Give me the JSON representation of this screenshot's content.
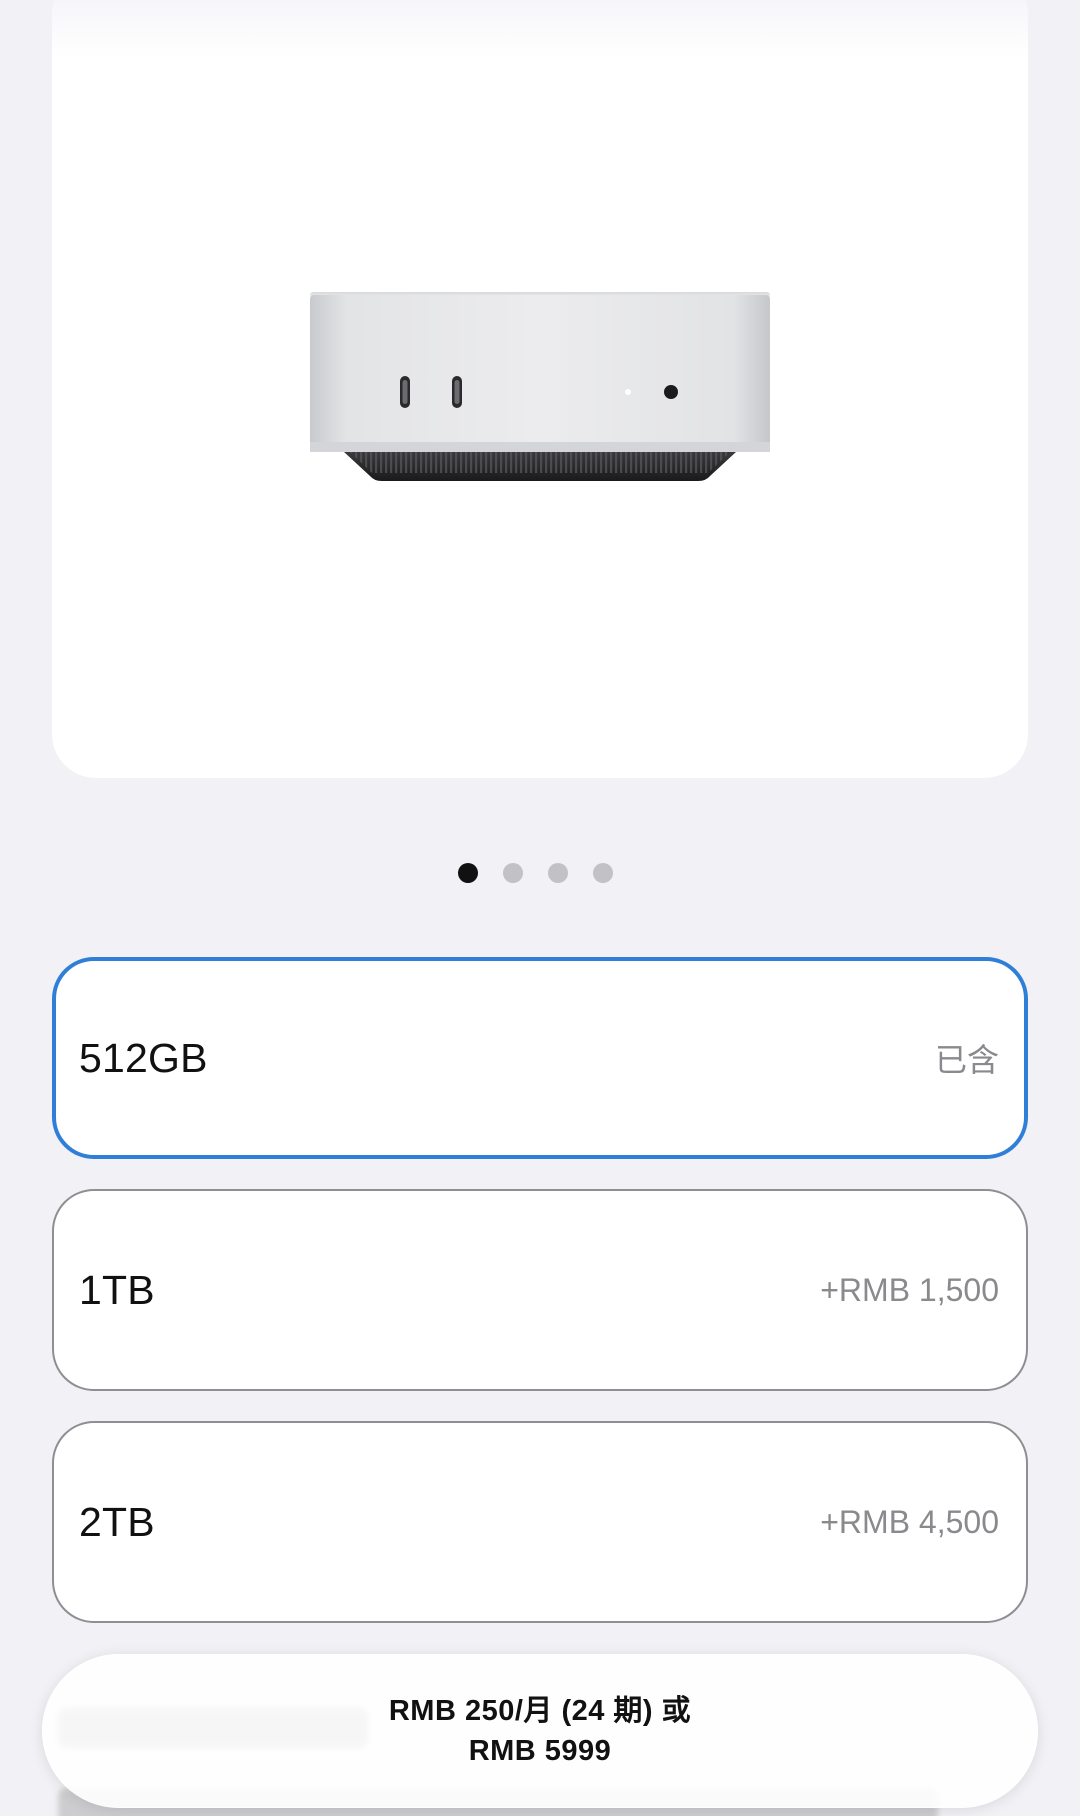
{
  "product": {
    "image_icon": "mac-mini-image"
  },
  "carousel": {
    "page_count": 4,
    "active_index": 0
  },
  "storage_options": [
    {
      "capacity": "512GB",
      "price": "已含",
      "selected": true
    },
    {
      "capacity": "1TB",
      "price": "+RMB 1,500",
      "selected": false
    },
    {
      "capacity": "2TB",
      "price": "+RMB 4,500",
      "selected": false
    }
  ],
  "price_bar": {
    "line1": "RMB 250/月 (24 期) 或",
    "line2": "RMB 5999"
  },
  "colors": {
    "background": "#f2f1f6",
    "selected_border": "#2f7ed8",
    "unselected_border": "#8e8e93"
  }
}
